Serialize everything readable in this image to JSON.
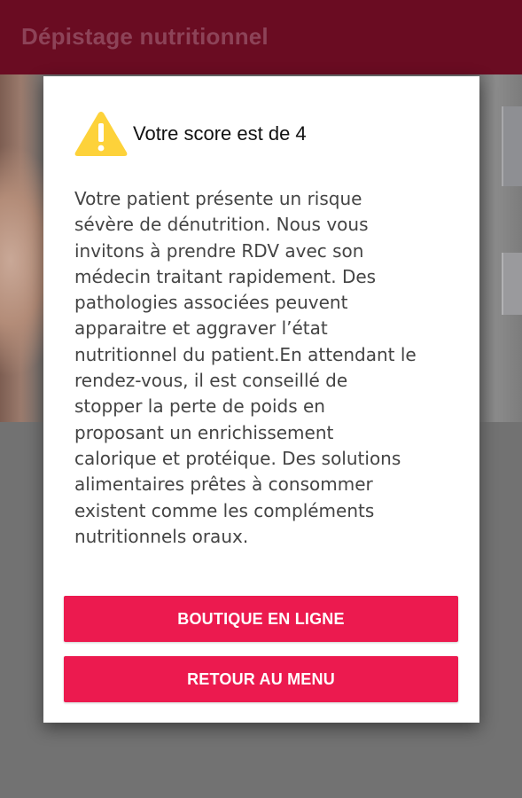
{
  "appbar": {
    "title": "Dépistage nutritionnel",
    "color": "#6a0c22"
  },
  "dialog": {
    "icon": "warning-triangle-icon",
    "icon_color": "#fdd23a",
    "title": "Votre score est de 4",
    "body": "Votre patient présente un risque\nsévère de dénutrition. Nous vous\ninvitons à prendre RDV avec son\nmédecin traitant rapidement. Des\npathologies associées peuvent\napparaitre et aggraver l’état\nnutritionnel du patient.En attendant le\nrendez-vous, il est conseillé de\nstopper la perte de poids en\nproposant un enrichissement\ncalorique et protéique. Des solutions\nalimentaires prêtes à consommer\nexistent comme les compléments\nnutritionnels oraux.",
    "buttons": {
      "shop_label": "BOUTIQUE EN LIGNE",
      "menu_label": "RETOUR AU MENU"
    },
    "button_color": "#ec1a4f"
  }
}
